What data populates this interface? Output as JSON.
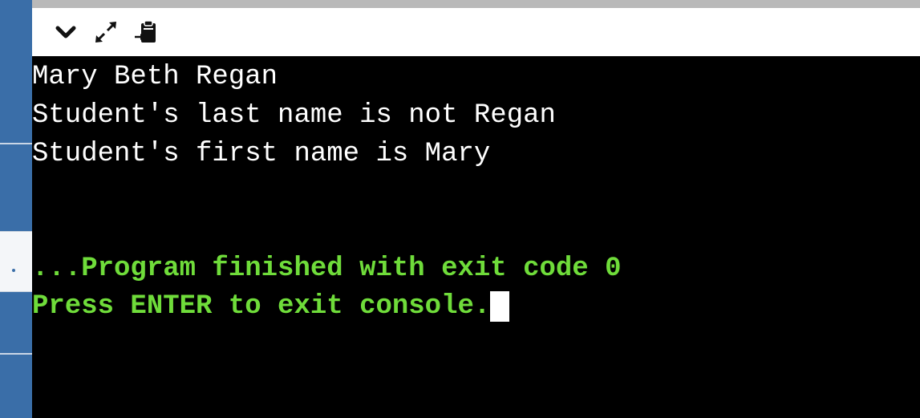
{
  "toolbar": {
    "buttons": [
      {
        "icon": "chevron-down-icon"
      },
      {
        "icon": "expand-icon"
      },
      {
        "icon": "clipboard-paste-icon"
      }
    ]
  },
  "console": {
    "output_lines": [
      "Mary Beth Regan",
      "Student's last name is not Regan",
      "Student's first name is Mary"
    ],
    "exit_message": "...Program finished with exit code 0",
    "prompt": "Press ENTER to exit console.",
    "text_color": "#ffffff",
    "system_color": "#6fdc3a",
    "background": "#000000"
  }
}
